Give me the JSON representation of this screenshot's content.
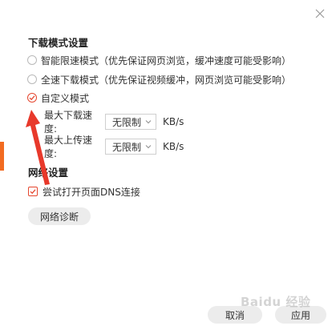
{
  "download_mode": {
    "title": "下载模式设置",
    "options": [
      {
        "label": "智能限速模式（优先保证网页浏览，缓冲速度可能受影响）",
        "selected": false
      },
      {
        "label": "全速下载模式（优先保证视频缓冲，网页浏览可能受影响）",
        "selected": false
      },
      {
        "label": "自定义模式",
        "selected": true
      }
    ],
    "max_download": {
      "label": "最大下载速度:",
      "value": "无限制",
      "unit": "KB/s"
    },
    "max_upload": {
      "label": "最大上传速度:",
      "value": "无限制",
      "unit": "KB/s"
    }
  },
  "network": {
    "title": "网络设置",
    "dns_checkbox": {
      "label": "尝试打开页面DNS连接",
      "checked": true
    },
    "diagnose_button": "网络诊断"
  },
  "footer": {
    "cancel_label": "取消",
    "apply_label": "应用"
  },
  "watermark": "Baidu 经验",
  "colors": {
    "accent": "#e5462e",
    "side_accent": "#f26b21",
    "annotation_arrow": "#e8392b"
  },
  "icons": {
    "close": "close-icon",
    "dropdown": "chevron-down-icon",
    "annotation": "red-arrow"
  }
}
